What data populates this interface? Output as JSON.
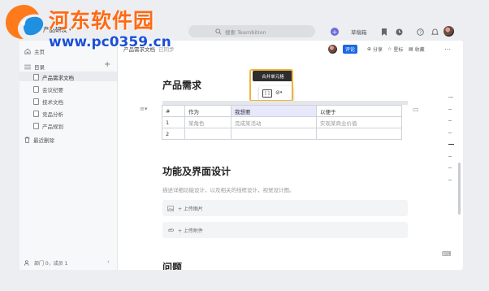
{
  "watermark": {
    "title": "河东软件园",
    "url": "www.pc0359.cn"
  },
  "topbar": {
    "project_name": "产品研发",
    "search_placeholder": "搜索 Teambition",
    "draft_label": "草稿箱"
  },
  "sidebar": {
    "home": "主页",
    "toc": "目录",
    "items": [
      "产品需求文档",
      "会议纪要",
      "技术文档",
      "竞品分析",
      "产品规划"
    ],
    "recycle": "最近删除",
    "footer": "部门 0，成员 1"
  },
  "doc": {
    "breadcrumb": "产品需求文档",
    "sync_status": "已同步",
    "comment_label": "评论",
    "share_label": "分享",
    "pin_label": "星标",
    "favorite_label": "收藏",
    "heading1": "产品需求",
    "heading2": "功能及界面设计",
    "heading3": "问题",
    "description": "描述详细功能设计，以及相关的线框设计，视觉设计图。",
    "upload_image": "+ 上传图片",
    "upload_file": "+ 上传附件"
  },
  "table": {
    "headers": [
      "#",
      "作为",
      "我想要",
      "以便于"
    ],
    "rows": [
      [
        "1",
        "某角色",
        "完成某活动",
        "实现某商业价值"
      ],
      [
        "2",
        "",
        "",
        ""
      ]
    ]
  },
  "tooltip": {
    "text": "合并单元格"
  },
  "colors": {
    "accent": "#1b66e5",
    "highlight": "#f0b43a",
    "watermark_orange": "#ff6a14",
    "watermark_blue": "#1b4fd6"
  }
}
